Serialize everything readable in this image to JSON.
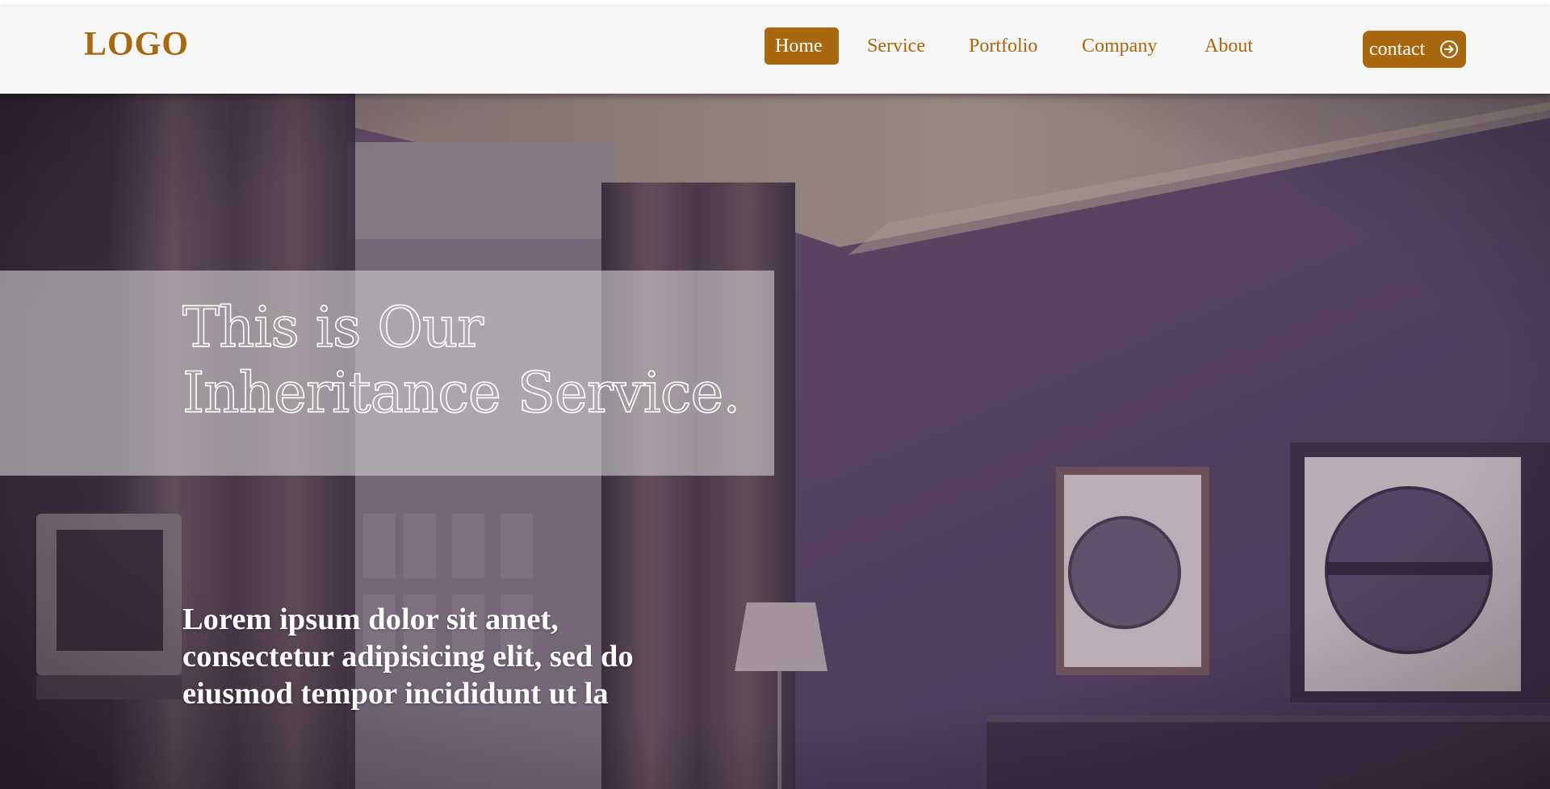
{
  "header": {
    "logo": "LOGO",
    "nav": [
      "Home",
      "Service",
      "Portfolio",
      "Company",
      "About"
    ],
    "active_nav": "Home",
    "contact_label": "contact",
    "contact_icon": "arrow-right-circle-icon"
  },
  "hero": {
    "title_line1": "This is Our",
    "title_line2": "Inheritance Service.",
    "body": "Lorem ipsum dolor sit amet, consectetur adipisicing elit, sed do eiusmod tempor incididunt ut la",
    "background": "hotel-room-photo"
  },
  "colors": {
    "accent": "#a8680f",
    "header_bg": "#f6f6f6"
  }
}
